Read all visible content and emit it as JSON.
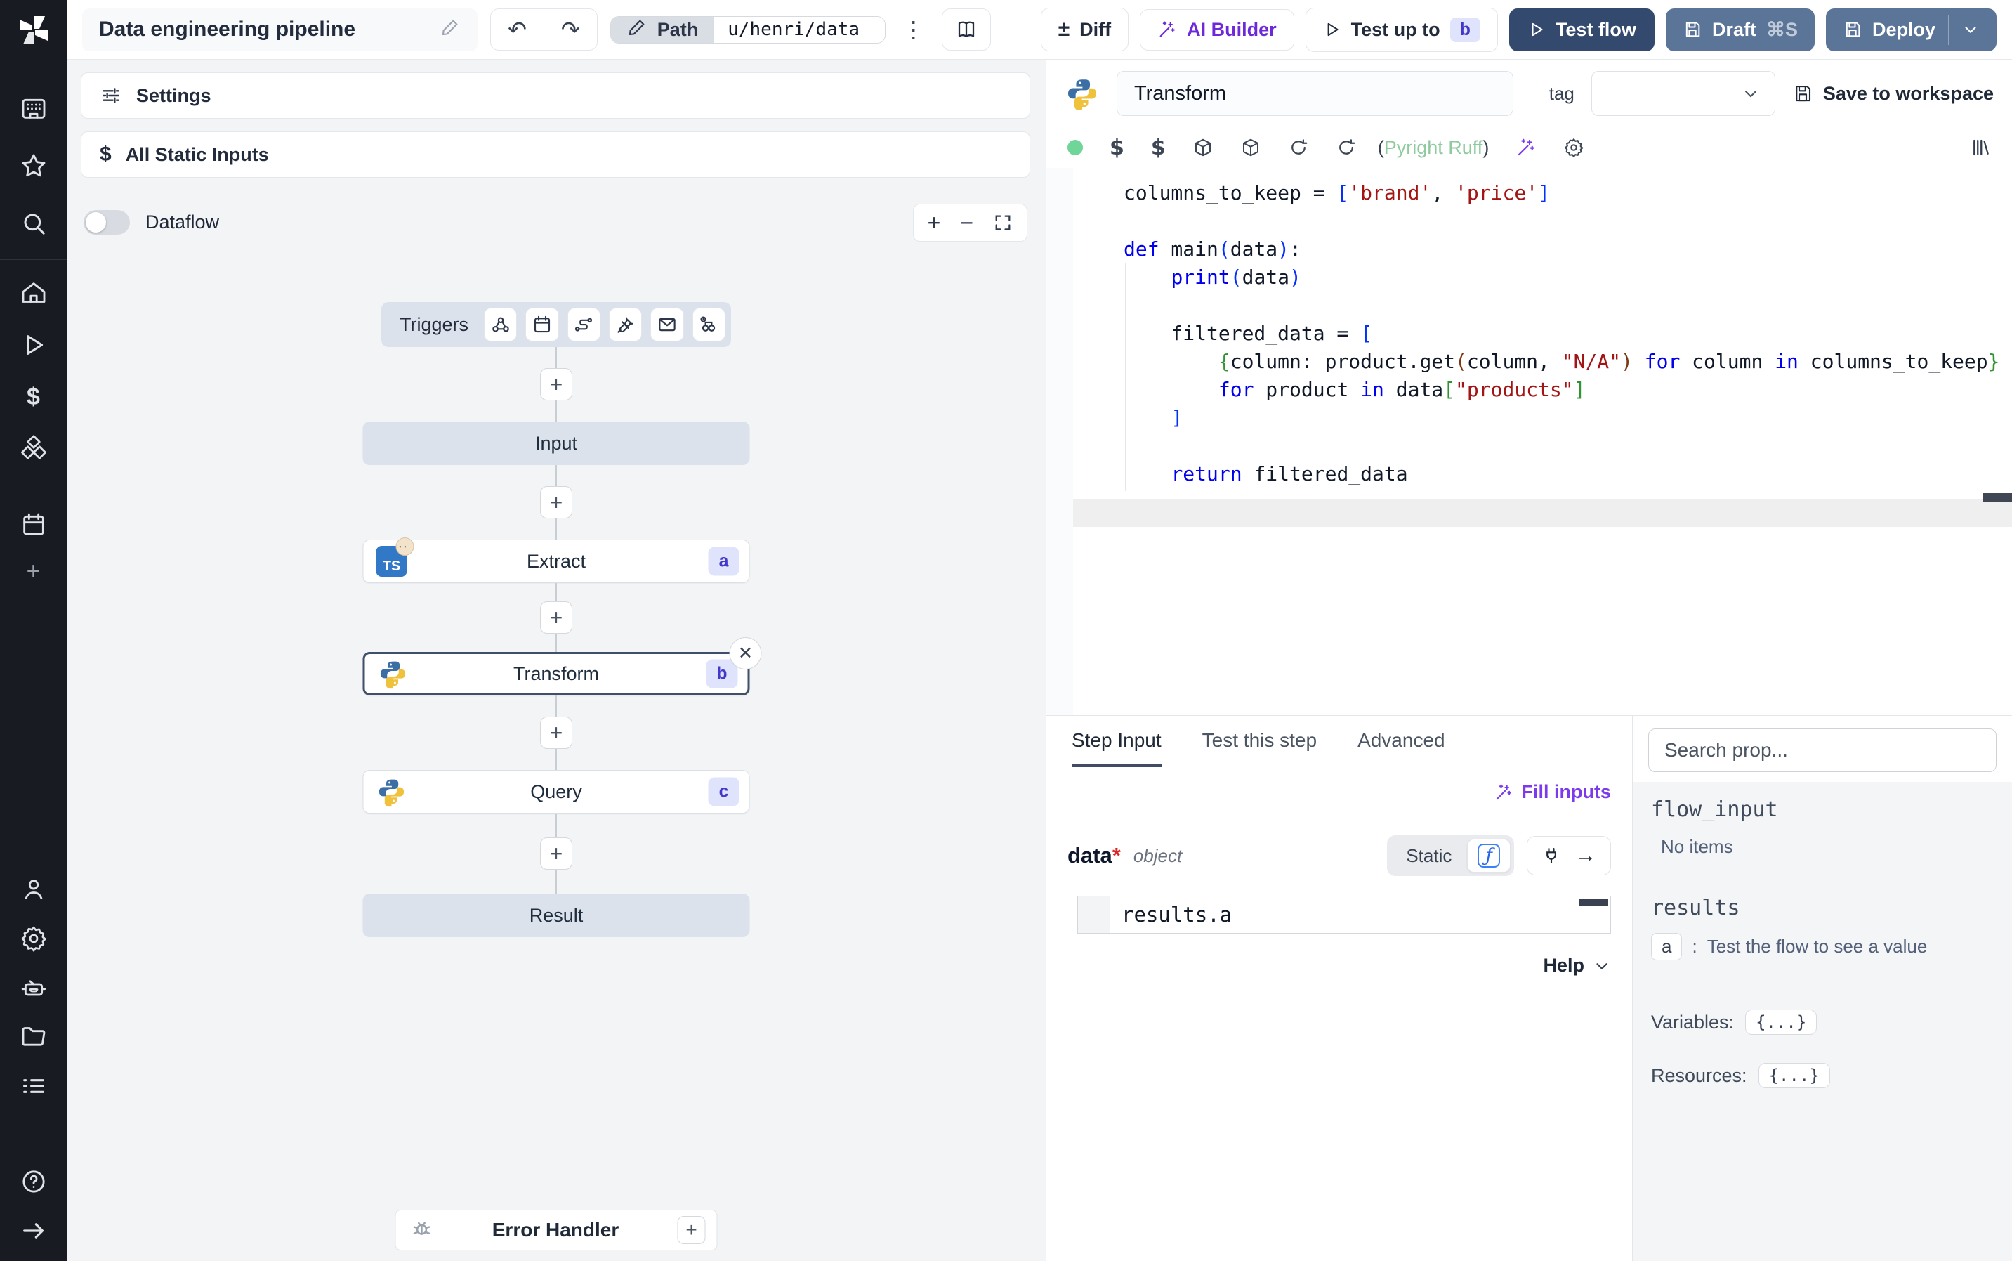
{
  "header": {
    "title": "Data engineering pipeline",
    "path_label": "Path",
    "path_value": "u/henri/data_",
    "diff": "Diff",
    "ai_builder": "AI Builder",
    "test_up_to": "Test up to",
    "test_up_to_chip": "b",
    "test_flow": "Test flow",
    "draft": "Draft",
    "draft_shortcut": "⌘S",
    "deploy": "Deploy"
  },
  "colors": {
    "accent_purple": "#6d28d9",
    "dark_button": "#334a6e",
    "slate_button": "#5b7599",
    "node_tint": "#dbe2ec",
    "badge_bg": "#dfe3fb",
    "badge_text": "#4338ca",
    "lint_green": "#8fca9f"
  },
  "sidebar": {
    "icons_top": [
      "workspace-icon",
      "star-icon",
      "search-icon"
    ],
    "icons_mid": [
      "home-icon",
      "runs-icon",
      "variables-icon",
      "resources-icon",
      "schedules-icon",
      "plus-icon"
    ],
    "icons_bottom": [
      "user-icon",
      "settings-icon",
      "workers-icon",
      "folders-icon",
      "logs-icon",
      "help-icon",
      "collapse-icon"
    ]
  },
  "flow_panel": {
    "settings": "Settings",
    "all_static_inputs": "All Static Inputs",
    "dataflow": "Dataflow",
    "triggers_label": "Triggers",
    "trigger_icons": [
      "webhook-icon",
      "schedule-icon",
      "route-icon",
      "plug-icon",
      "email-icon",
      "poll-icon"
    ],
    "nodes": {
      "input": "Input",
      "extract": "Extract",
      "extract_badge": "a",
      "transform": "Transform",
      "transform_badge": "b",
      "query": "Query",
      "query_badge": "c",
      "result": "Result"
    },
    "error_handler": "Error Handler"
  },
  "editor": {
    "step_name": "Transform",
    "tag_label": "tag",
    "save_to_workspace": "Save to workspace",
    "lint_open": "(",
    "lint_name": "Pyright Ruff",
    "lint_close": ")",
    "code": [
      [
        {
          "t": "columns_to_keep = "
        },
        {
          "t": "[",
          "c": "b1"
        },
        {
          "t": "'brand'",
          "c": "s"
        },
        {
          "t": ", "
        },
        {
          "t": "'price'",
          "c": "s"
        },
        {
          "t": "]",
          "c": "b1"
        }
      ],
      [],
      [
        {
          "t": "def",
          "c": "k"
        },
        {
          "t": " main"
        },
        {
          "t": "(",
          "c": "b1"
        },
        {
          "t": "data"
        },
        {
          "t": ")",
          "c": "b1"
        },
        {
          "t": ":"
        }
      ],
      [
        {
          "t": "    "
        },
        {
          "t": "print",
          "c": "k"
        },
        {
          "t": "(",
          "c": "b1"
        },
        {
          "t": "data"
        },
        {
          "t": ")",
          "c": "b1"
        }
      ],
      [],
      [
        {
          "t": "    filtered_data = "
        },
        {
          "t": "[",
          "c": "b1"
        }
      ],
      [
        {
          "t": "        "
        },
        {
          "t": "{",
          "c": "b2"
        },
        {
          "t": "column: product.get"
        },
        {
          "t": "(",
          "c": "b3"
        },
        {
          "t": "column, "
        },
        {
          "t": "\"N/A\"",
          "c": "s"
        },
        {
          "t": ")",
          "c": "b3"
        },
        {
          "t": " "
        },
        {
          "t": "for",
          "c": "k"
        },
        {
          "t": " column "
        },
        {
          "t": "in",
          "c": "k"
        },
        {
          "t": " columns_to_keep"
        },
        {
          "t": "}",
          "c": "b2"
        }
      ],
      [
        {
          "t": "        "
        },
        {
          "t": "for",
          "c": "k"
        },
        {
          "t": " product "
        },
        {
          "t": "in",
          "c": "k"
        },
        {
          "t": " data"
        },
        {
          "t": "[",
          "c": "b2"
        },
        {
          "t": "\"products\"",
          "c": "s"
        },
        {
          "t": "]",
          "c": "b2"
        }
      ],
      [
        {
          "t": "    "
        },
        {
          "t": "]",
          "c": "b1"
        }
      ],
      [],
      [
        {
          "t": "    "
        },
        {
          "t": "return",
          "c": "k"
        },
        {
          "t": " filtered_data"
        }
      ]
    ]
  },
  "tabs": {
    "step_input": "Step Input",
    "test_this_step": "Test this step",
    "advanced": "Advanced"
  },
  "step_input": {
    "fill_inputs": "Fill inputs",
    "arg_name": "data",
    "arg_required": "*",
    "arg_type": "object",
    "static_label": "Static",
    "f_symbol": "ƒ",
    "expression": "results.a",
    "help": "Help"
  },
  "props": {
    "search_placeholder": "Search prop...",
    "flow_input": "flow_input",
    "no_items": "No items",
    "results": "results",
    "result_key": "a",
    "result_sep": ":",
    "result_hint": "Test the flow to see a value",
    "variables_label": "Variables:",
    "resources_label": "Resources:",
    "variables_value": "{...}",
    "resources_value": "{...}"
  }
}
